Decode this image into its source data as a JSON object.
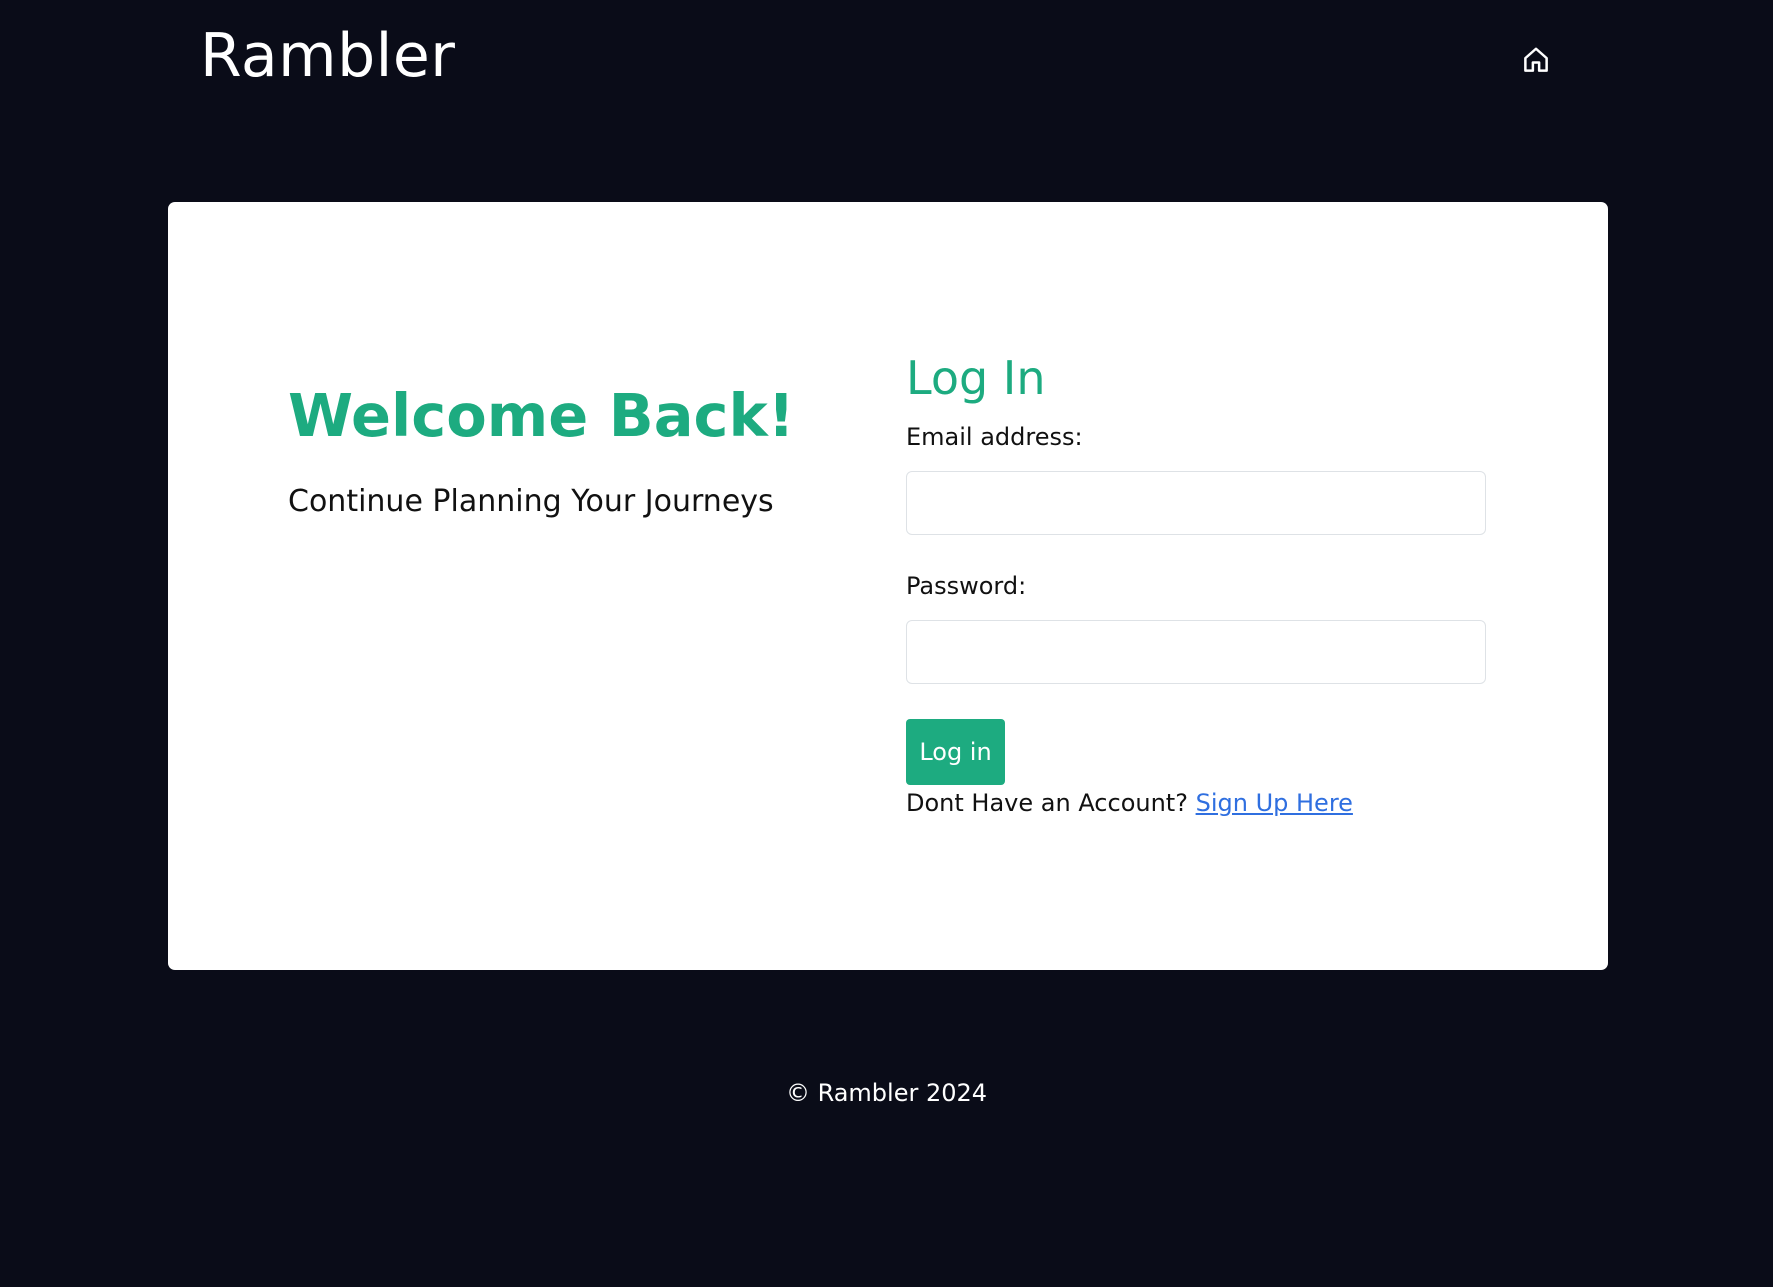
{
  "header": {
    "brand": "Rambler",
    "home_icon": "home-icon"
  },
  "welcome": {
    "title": "Welcome Back!",
    "subtitle": "Continue Planning Your Journeys"
  },
  "login_form": {
    "title": "Log In",
    "email_label": "Email address:",
    "email_value": "",
    "email_placeholder": "",
    "password_label": "Password:",
    "password_value": "",
    "password_placeholder": "",
    "submit_label": "Log in",
    "signup_prompt": "Dont Have an Account?",
    "signup_link": "Sign Up Here"
  },
  "footer": {
    "text": "© Rambler 2024"
  },
  "colors": {
    "page_background": "#0a0c18",
    "accent": "#1dab80",
    "link": "#2f6fe0",
    "card_background": "#ffffff"
  }
}
